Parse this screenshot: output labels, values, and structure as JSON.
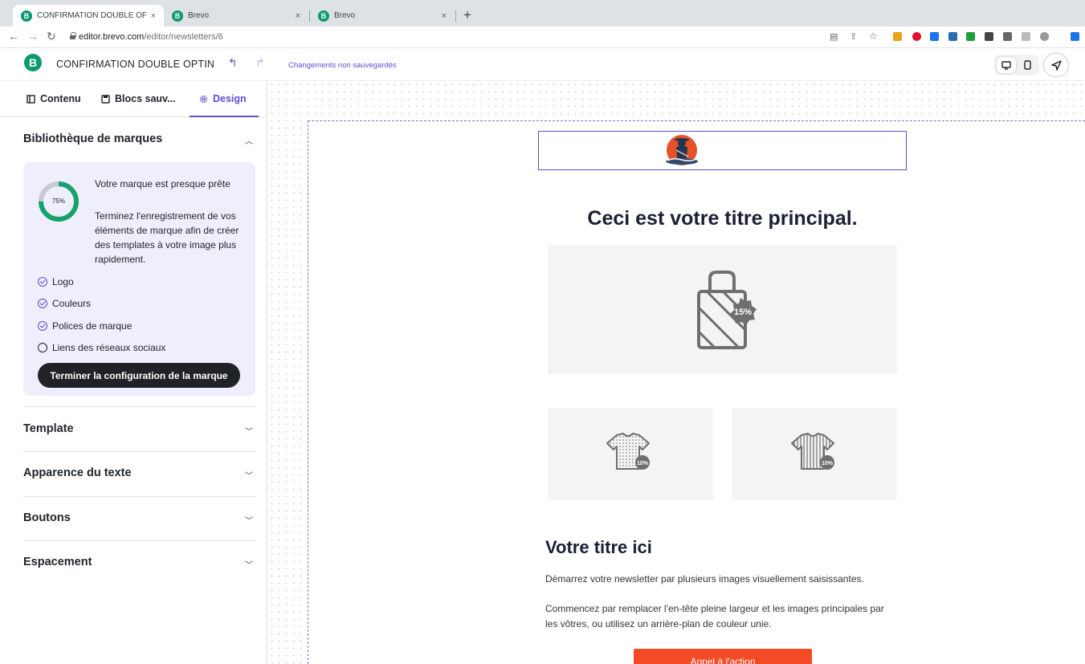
{
  "browser": {
    "tabs": [
      {
        "title": "CONFIRMATION DOUBLE OPTIN",
        "favicon": "B",
        "active": true
      },
      {
        "title": "Brevo",
        "favicon": "B",
        "active": false
      },
      {
        "title": "Brevo",
        "favicon": "B",
        "active": false
      }
    ],
    "new_tab_icon": "+",
    "close_icon": "×",
    "url_host": "editor.brevo.com",
    "url_path": "/editor/newsletters/6"
  },
  "appbar": {
    "brand_letter": "B",
    "campaign_name": "CONFIRMATION DOUBLE OPTIN",
    "status": "Changements non sauvegardés"
  },
  "panel": {
    "tabs": [
      {
        "label": "Contenu",
        "icon": "layout-icon"
      },
      {
        "label": "Blocs sauv...",
        "icon": "save-icon"
      },
      {
        "label": "Design",
        "icon": "gear-icon",
        "active": true
      }
    ],
    "brand_library": {
      "title": "Bibliothèque de marques",
      "progress_label": "75%",
      "progress": 0.75,
      "card_title": "Votre marque est presque prête",
      "card_text": "Terminez l'enregistrement de vos éléments de marque afin de créer des templates à votre image plus rapidement.",
      "checklist": [
        {
          "label": "Logo",
          "done": true
        },
        {
          "label": "Couleurs",
          "done": true
        },
        {
          "label": "Polices de marque",
          "done": true
        },
        {
          "label": "Liens des réseaux sociaux",
          "done": false
        }
      ],
      "button": "Terminer la configuration de la marque"
    },
    "sections": [
      "Template",
      "Apparence du texte",
      "Boutons",
      "Espacement"
    ]
  },
  "email": {
    "main_title": "Ceci est votre titre principal.",
    "hero_badge": "15%",
    "tile_badges": [
      "10%",
      "10%"
    ],
    "subtitle": "Votre titre ici",
    "paragraph_1": "Démarrez votre newsletter par plusieurs images visuellement saisissantes.",
    "paragraph_2": "Commencez par remplacer l'en-tête pleine largeur et les images principales par les vôtres, ou utilisez un arrière-plan de couleur unie.",
    "cta": "Appel à l'action"
  },
  "colors": {
    "accent": "#5a4fcf",
    "brand_green": "#0b996e",
    "cta": "#f44a25",
    "progress_green": "#15a36b"
  }
}
